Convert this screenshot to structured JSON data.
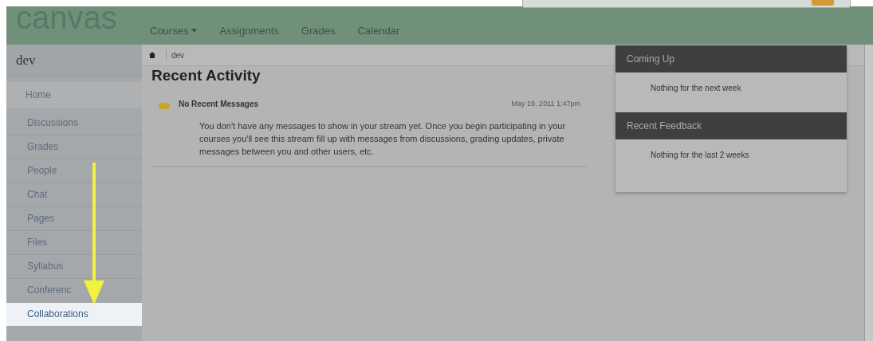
{
  "header": {
    "logo": "canvas",
    "nav": [
      {
        "label": "Courses",
        "dropdown": true
      },
      {
        "label": "Assignments",
        "dropdown": false
      },
      {
        "label": "Grades",
        "dropdown": false
      },
      {
        "label": "Calendar",
        "dropdown": false
      }
    ]
  },
  "breadcrumb": {
    "items": [
      "dev"
    ]
  },
  "sidebar": {
    "course_title": "dev",
    "items": [
      {
        "label": "Home",
        "kind": "home",
        "selected": false
      },
      {
        "label": "Discussions",
        "kind": "tab",
        "selected": false
      },
      {
        "label": "Grades",
        "kind": "tab",
        "selected": false
      },
      {
        "label": "People",
        "kind": "tab",
        "selected": false
      },
      {
        "label": "Chat",
        "kind": "tab",
        "selected": false
      },
      {
        "label": "Pages",
        "kind": "tab",
        "selected": false
      },
      {
        "label": "Files",
        "kind": "tab",
        "selected": false
      },
      {
        "label": "Syllabus",
        "kind": "tab",
        "selected": false
      },
      {
        "label": "Conferenc",
        "kind": "tab",
        "selected": false
      },
      {
        "label": "Collaborations",
        "kind": "tab",
        "selected": true
      }
    ]
  },
  "main": {
    "title": "Recent Activity",
    "messages": [
      {
        "title": "No Recent Messages",
        "date": "May 19, 2011 1:47pm",
        "body": "You don't have any messages to show in your stream yet. Once you begin participating in your courses you'll see this stream fill up with messages from discussions, grading updates, private messages between you and other users, etc."
      }
    ]
  },
  "right_panels": [
    {
      "title": "Coming Up",
      "text": "Nothing for the next week"
    },
    {
      "title": "Recent Feedback",
      "text": "Nothing for the last 2 weeks"
    }
  ]
}
